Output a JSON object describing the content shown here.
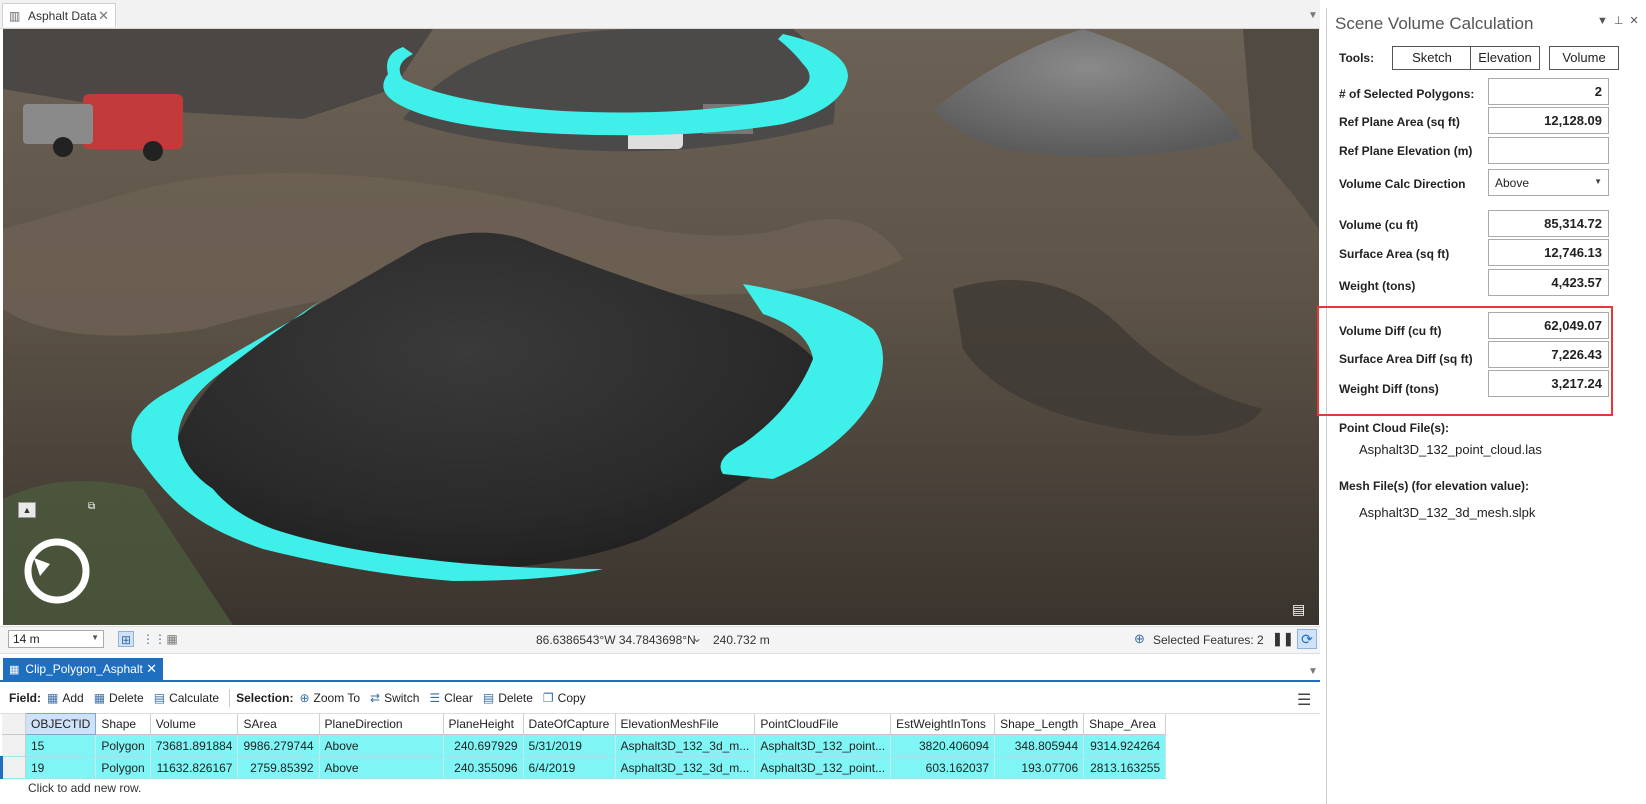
{
  "map_tab": {
    "title": "Asphalt Data",
    "close": "✕"
  },
  "status_bar": {
    "scale": "14 m",
    "coordinates": "86.6386543°W 34.7843698°N",
    "elevation": "240.732 m",
    "selected_features": "Selected Features: 2"
  },
  "table_tab": {
    "title": "Clip_Polygon_Asphalt",
    "close": "✕"
  },
  "table_toolbar": {
    "field_label": "Field:",
    "add": "Add",
    "delete": "Delete",
    "calculate": "Calculate",
    "selection_label": "Selection:",
    "zoom_to": "Zoom To",
    "switch": "Switch",
    "clear": "Clear",
    "sel_delete": "Delete",
    "copy": "Copy"
  },
  "table": {
    "columns": [
      "OBJECTID",
      "Shape",
      "Volume",
      "SArea",
      "PlaneDirection",
      "PlaneHeight",
      "DateOfCapture",
      "ElevationMeshFile",
      "PointCloudFile",
      "EstWeightInTons",
      "Shape_Length",
      "Shape_Area"
    ],
    "rows": [
      [
        "15",
        "Polygon",
        "73681.891884",
        "9986.279744",
        "Above",
        "240.697929",
        "5/31/2019",
        "Asphalt3D_132_3d_m...",
        "Asphalt3D_132_point...",
        "3820.406094",
        "348.805944",
        "9314.924264"
      ],
      [
        "19",
        "Polygon",
        "11632.826167",
        "2759.85392",
        "Above",
        "240.355096",
        "6/4/2019",
        "Asphalt3D_132_3d_m...",
        "Asphalt3D_132_point...",
        "603.162037",
        "193.07706",
        "2813.163255"
      ]
    ],
    "add_row_text": "Click to add new row."
  },
  "panel": {
    "title": "Scene Volume Calculation",
    "tools_label": "Tools:",
    "sketch": "Sketch",
    "elevation": "Elevation",
    "volume": "Volume",
    "selected_polygons_label": "# of Selected Polygons:",
    "selected_polygons": "2",
    "ref_area_label": "Ref Plane Area (sq ft)",
    "ref_area": "12,128.09",
    "ref_elev_label": "Ref Plane Elevation (m)",
    "ref_elev": "",
    "direction_label": "Volume Calc Direction",
    "direction": "Above",
    "volume_label": "Volume (cu ft)",
    "volume_value": "85,314.72",
    "surface_label": "Surface Area (sq ft)",
    "surface_value": "12,746.13",
    "weight_label": "Weight (tons)",
    "weight_value": "4,423.57",
    "vol_diff_label": "Volume Diff (cu ft)",
    "vol_diff": "62,049.07",
    "sa_diff_label": "Surface Area Diff (sq ft)",
    "sa_diff": "7,226.43",
    "wt_diff_label": "Weight Diff (tons)",
    "wt_diff": "3,217.24",
    "pc_label": "Point Cloud File(s):",
    "pc_file": "Asphalt3D_132_point_cloud.las",
    "mesh_label": "Mesh File(s) (for elevation value):",
    "mesh_file": "Asphalt3D_132_3d_mesh.slpk"
  },
  "colors": {
    "accent": "#1f6fc1",
    "selection": "#7ff5f6",
    "highlight_box": "#e3393b",
    "polygon": "#3ff0ea"
  }
}
